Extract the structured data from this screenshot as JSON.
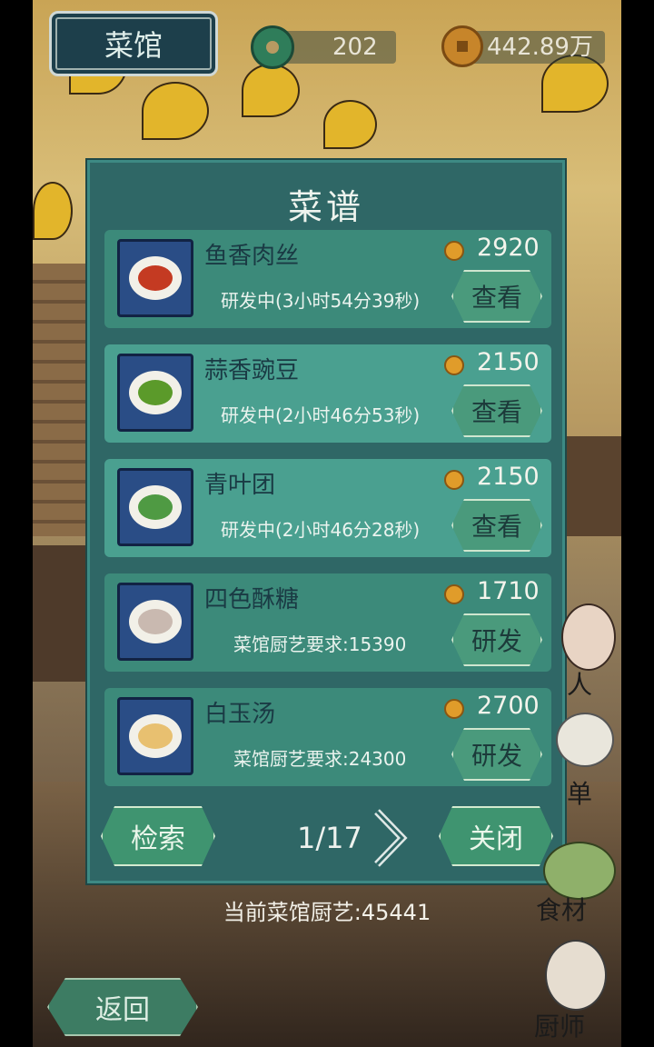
{
  "header": {
    "title": "菜馆",
    "jade_count": "202",
    "coin_count": "442.89万"
  },
  "panel": {
    "title": "菜谱",
    "recipes": [
      {
        "name": "鱼香肉丝",
        "price": "2920",
        "status": "研发中(3小时54分39秒)",
        "action": "查看",
        "food_color": "#c43a22"
      },
      {
        "name": "蒜香豌豆",
        "price": "2150",
        "status": "研发中(2小时46分53秒)",
        "action": "查看",
        "food_color": "#5b9a2a"
      },
      {
        "name": "青叶团",
        "price": "2150",
        "status": "研发中(2小时46分28秒)",
        "action": "查看",
        "food_color": "#4f9a43"
      },
      {
        "name": "四色酥糖",
        "price": "1710",
        "status": "菜馆厨艺要求:15390",
        "action": "研发",
        "food_color": "#c9b9b0"
      },
      {
        "name": "白玉汤",
        "price": "2700",
        "status": "菜馆厨艺要求:24300",
        "action": "研发",
        "food_color": "#e8c070"
      }
    ],
    "search_label": "检索",
    "page_indicator": "1/17",
    "close_label": "关闭"
  },
  "footer": {
    "skill_text": "当前菜馆厨艺:45441",
    "back_label": "返回"
  },
  "side_menu": {
    "person_label": "人",
    "menu_label": "单",
    "ingredients_label": "食材",
    "chef_label": "厨师"
  },
  "colors": {
    "panel_bg": "#2f6766",
    "row_bg": "#3c8a7a",
    "row_dev_bg": "#4aa090",
    "accent_gold": "#e09c2a"
  }
}
